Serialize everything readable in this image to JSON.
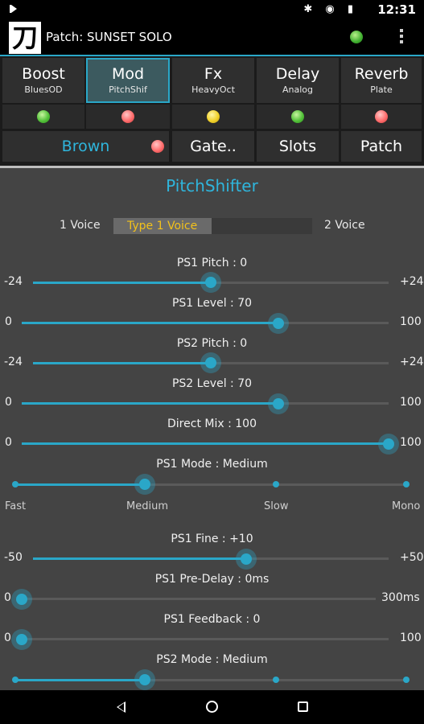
{
  "status_bar": {
    "time": "12:31",
    "icons": [
      "media-play-icon",
      "bluetooth-icon",
      "wifi-icon",
      "battery-icon"
    ]
  },
  "app_bar": {
    "logo_glyph": "刀",
    "title": "Patch: SUNSET SOLO",
    "patch_led": "green"
  },
  "pedals": [
    {
      "name": "Boost",
      "sub": "BluesOD",
      "led": "green",
      "selected": false
    },
    {
      "name": "Mod",
      "sub": "PitchShif",
      "led": "red",
      "selected": true
    },
    {
      "name": "Fx",
      "sub": "HeavyOct",
      "led": "yellow",
      "selected": false
    },
    {
      "name": "Delay",
      "sub": "Analog",
      "led": "green",
      "selected": false
    },
    {
      "name": "Reverb",
      "sub": "Plate",
      "led": "red",
      "selected": false
    }
  ],
  "buttons": {
    "brown": "Brown",
    "brown_led": "red",
    "gate": "Gate..",
    "slots": "Slots",
    "patch": "Patch"
  },
  "panel": {
    "title": "PitchShifter",
    "voice_left": "1 Voice",
    "voice_right": "2 Voice",
    "voice_value": "Type 1 Voice",
    "voice_fraction": 0.5,
    "controls": [
      {
        "label": "PS1 Pitch : 0",
        "min": "-24",
        "max": "+24",
        "value": 0.5
      },
      {
        "label": "PS1 Level : 70",
        "min": "0",
        "max": "100",
        "value": 0.7
      },
      {
        "label": "PS2 Pitch : 0",
        "min": "-24",
        "max": "+24",
        "value": 0.5
      },
      {
        "label": "PS2 Level : 70",
        "min": "0",
        "max": "100",
        "value": 0.7
      },
      {
        "label": "Direct Mix : 100",
        "min": "0",
        "max": "100",
        "value": 1.0
      },
      {
        "label": "PS1 Mode : Medium",
        "steps": [
          "Fast",
          "Medium",
          "Slow",
          "Mono"
        ],
        "selected": 1
      },
      {
        "label": "PS1 Fine : +10",
        "min": "-50",
        "max": "+50",
        "value": 0.6
      },
      {
        "label": "PS1 Pre-Delay : 0ms",
        "min": "0",
        "max": "300ms",
        "value": 0.0
      },
      {
        "label": "PS1 Feedback : 0",
        "min": "0",
        "max": "100",
        "value": 0.0
      },
      {
        "label": "PS2 Mode : Medium",
        "selected": 1
      }
    ]
  },
  "colors": {
    "accent": "#2aa7c8",
    "voice_text": "#f2c11b"
  }
}
